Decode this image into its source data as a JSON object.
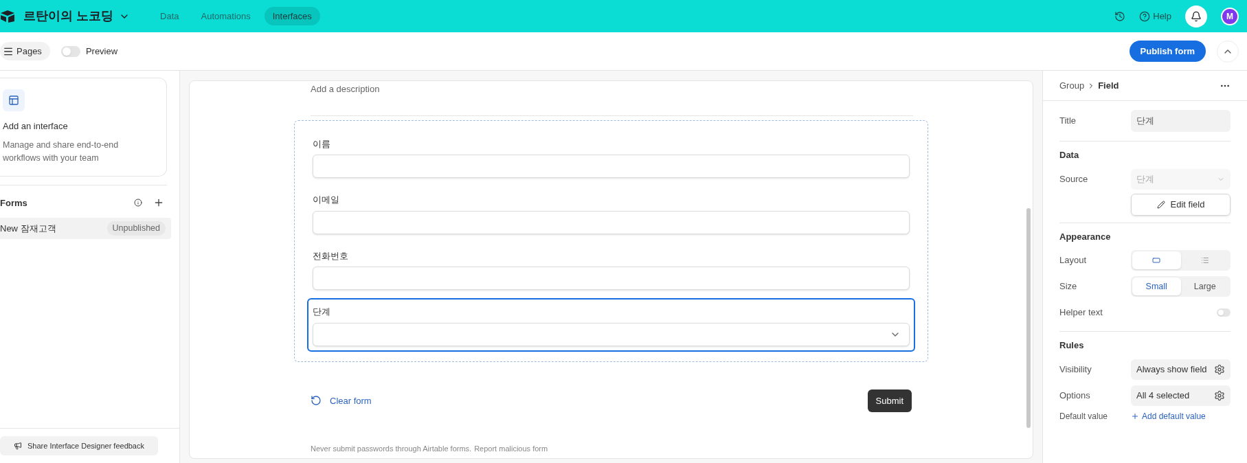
{
  "topbar": {
    "base_name": "르탄이의 노코딩",
    "nav": [
      {
        "label": "Data",
        "selected": false
      },
      {
        "label": "Automations",
        "selected": false
      },
      {
        "label": "Interfaces",
        "selected": true
      }
    ],
    "help": "Help",
    "avatar": "M"
  },
  "toolbar": {
    "pages": "Pages",
    "preview": {
      "label": "Preview",
      "on": false
    },
    "publish": "Publish form"
  },
  "sidebar": {
    "promo_title": "Add an interface",
    "promo_text": "Manage and share end-to-end workflows with your team",
    "section": "Forms",
    "items": [
      {
        "label": "New 잠재고객",
        "badge": "Unpublished",
        "selected": true
      }
    ],
    "feedback": "Share Interface Designer feedback"
  },
  "form": {
    "description_placeholder": "Add a description",
    "fields": [
      {
        "label": "이름",
        "kind": "text",
        "selected": false
      },
      {
        "label": "이메일",
        "kind": "text",
        "selected": false
      },
      {
        "label": "전화번호",
        "kind": "text",
        "selected": false
      },
      {
        "label": "단계",
        "kind": "select",
        "selected": true
      }
    ],
    "clear": "Clear form",
    "submit": "Submit",
    "footer": "Never submit passwords through Airtable forms.",
    "report": "Report malicious form"
  },
  "panel": {
    "breadcrumb_parent": "Group",
    "breadcrumb_current": "Field",
    "title_label": "Title",
    "title_value": "단계",
    "data": {
      "heading": "Data",
      "source_label": "Source",
      "source_value": "단계",
      "edit": "Edit field"
    },
    "appearance": {
      "heading": "Appearance",
      "layout_label": "Layout",
      "layout_options": [
        {
          "kind": "dropdown",
          "selected": true
        },
        {
          "kind": "list",
          "selected": false
        }
      ],
      "size_label": "Size",
      "size_options": [
        {
          "label": "Small",
          "selected": true
        },
        {
          "label": "Large",
          "selected": false
        }
      ],
      "helper_label": "Helper text",
      "helper_on": false
    },
    "rules": {
      "heading": "Rules",
      "rows": [
        {
          "label": "Visibility",
          "value": "Always show field"
        },
        {
          "label": "Options",
          "value": "All 4 selected"
        }
      ],
      "default_label": "Default value",
      "default_action": "Add default value"
    }
  }
}
